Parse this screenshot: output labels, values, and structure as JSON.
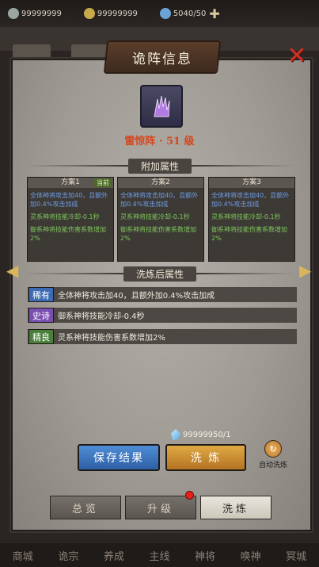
{
  "resources": [
    {
      "icon": "silver-ingot-icon",
      "value": "99999999",
      "color": "#9aa7a0"
    },
    {
      "icon": "jade-icon",
      "value": "99999999",
      "color": "#c8a84b"
    },
    {
      "icon": "stamina-icon",
      "value": "5040/50",
      "color": "#6aa3d6"
    }
  ],
  "modal": {
    "title": "诡阵信息",
    "formation_name": "雷惊阵 · 51 级",
    "bonus_section_title": "附加属性",
    "refined_section_title": "洗炼后属性"
  },
  "schemes": [
    {
      "name": "方案1",
      "badge": "当前",
      "lines": [
        "全体神将攻击加40，且额外加0.4%攻击加成",
        "灵系神将技能冷却-0.1秒",
        "御系神将技能伤害系数增加2%"
      ]
    },
    {
      "name": "方案2",
      "badge": "",
      "lines": [
        "全体神将攻击加40，且额外加0.4%攻击加成",
        "灵系神将技能冷却-0.1秒",
        "御系神将技能伤害系数增加2%"
      ]
    },
    {
      "name": "方案3",
      "badge": "",
      "lines": [
        "全体神将攻击加40，且额外加0.4%攻击加成",
        "灵系神将技能冷却-0.1秒",
        "御系神将技能伤害系数增加2%"
      ]
    }
  ],
  "refined_attrs": [
    {
      "rarity": "稀有",
      "rarity_color": "#3d6bb3",
      "text": "全体神将攻击加40，且额外加0.4%攻击加成"
    },
    {
      "rarity": "史诗",
      "rarity_color": "#7a4fb0",
      "text": "御系神将技能冷却-0.4秒"
    },
    {
      "rarity": "精良",
      "rarity_color": "#4a7f3a",
      "text": "灵系神将技能伤害系数增加2%"
    }
  ],
  "cost": "99999950/1",
  "buttons": {
    "save": "保存结果",
    "refine": "洗 炼",
    "auto": "自动洗炼"
  },
  "tabs": [
    "总览",
    "升级",
    "洗炼"
  ],
  "active_tab": 2,
  "bottom_nav": [
    "商城",
    "诡宗",
    "养成",
    "主线",
    "神将",
    "唤神",
    "冥城"
  ]
}
